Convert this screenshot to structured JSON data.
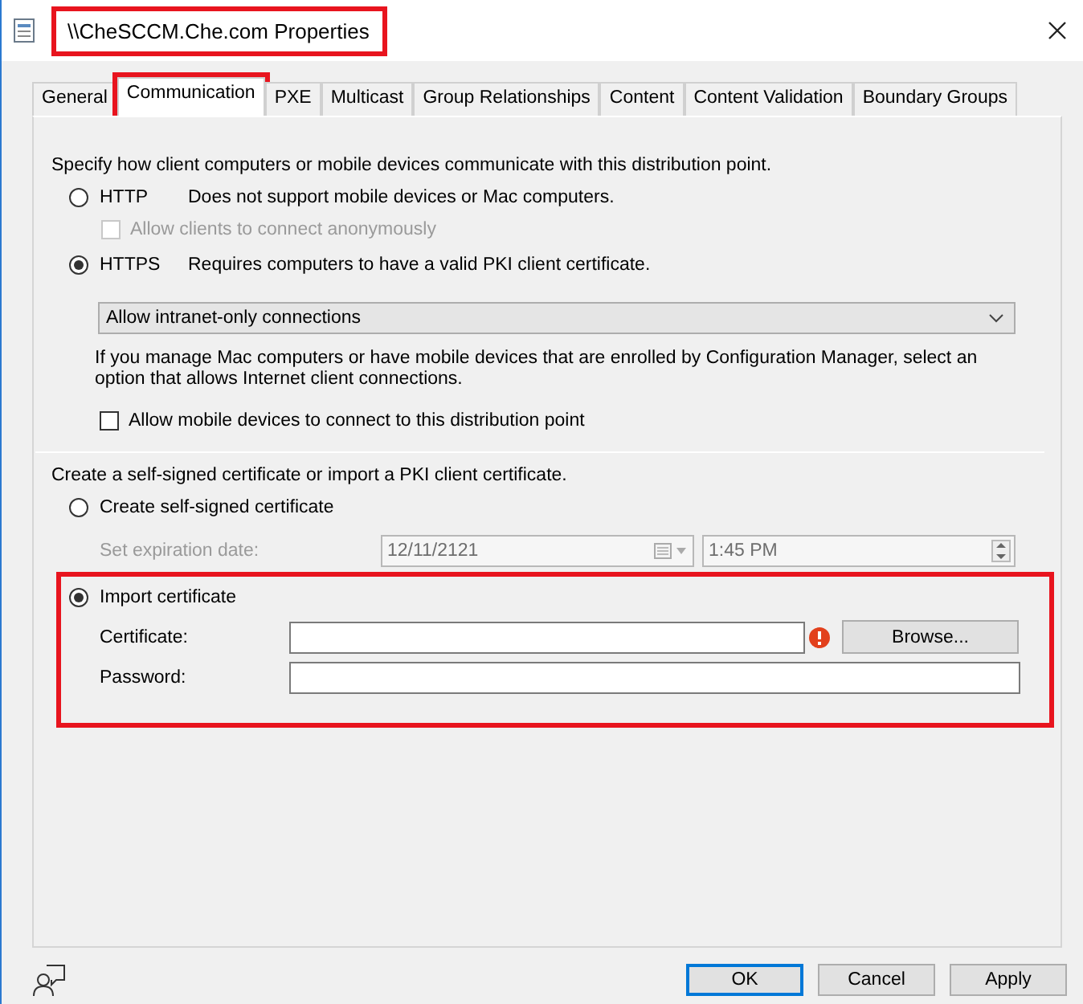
{
  "window": {
    "title": "\\\\CheSCCM.Che.com Properties",
    "title_highlighted": true
  },
  "tabs": [
    {
      "label": "General",
      "selected": false,
      "highlighted": false
    },
    {
      "label": "Communication",
      "selected": true,
      "highlighted": true
    },
    {
      "label": "PXE",
      "selected": false,
      "highlighted": false
    },
    {
      "label": "Multicast",
      "selected": false,
      "highlighted": false
    },
    {
      "label": "Group Relationships",
      "selected": false,
      "highlighted": false
    },
    {
      "label": "Content",
      "selected": false,
      "highlighted": false
    },
    {
      "label": "Content Validation",
      "selected": false,
      "highlighted": false
    },
    {
      "label": "Boundary Groups",
      "selected": false,
      "highlighted": false
    }
  ],
  "communication": {
    "intro": "Specify how client computers or mobile devices communicate with this distribution point.",
    "http": {
      "label": "HTTP",
      "description": "Does not support mobile devices or Mac computers.",
      "selected": false
    },
    "anonymous": {
      "label": "Allow clients to connect anonymously",
      "checked": false,
      "disabled": true
    },
    "https": {
      "label": "HTTPS",
      "description": "Requires computers to have a valid PKI client certificate.",
      "selected": true
    },
    "connection_dropdown": {
      "value": "Allow intranet-only connections"
    },
    "note": "If you manage Mac computers or have mobile devices that are enrolled by Configuration Manager, select an option that allows Internet client connections.",
    "mobile": {
      "label": "Allow mobile devices to connect to this distribution point",
      "checked": false
    }
  },
  "certificate": {
    "intro": "Create a self-signed certificate or import a PKI client certificate.",
    "self_signed": {
      "label": "Create self-signed certificate",
      "selected": false
    },
    "expiration": {
      "label": "Set expiration date:",
      "date": "12/11/2121",
      "time": "1:45 PM",
      "disabled": true
    },
    "import": {
      "label": "Import certificate",
      "selected": true,
      "highlighted": true,
      "fields": [
        {
          "label": "Certificate:",
          "error": true,
          "button": "Browse..."
        },
        {
          "label": "Password:",
          "error": false
        }
      ]
    }
  },
  "buttons": [
    {
      "label": "OK",
      "default": true
    },
    {
      "label": "Cancel",
      "default": false
    },
    {
      "label": "Apply",
      "default": false
    }
  ]
}
